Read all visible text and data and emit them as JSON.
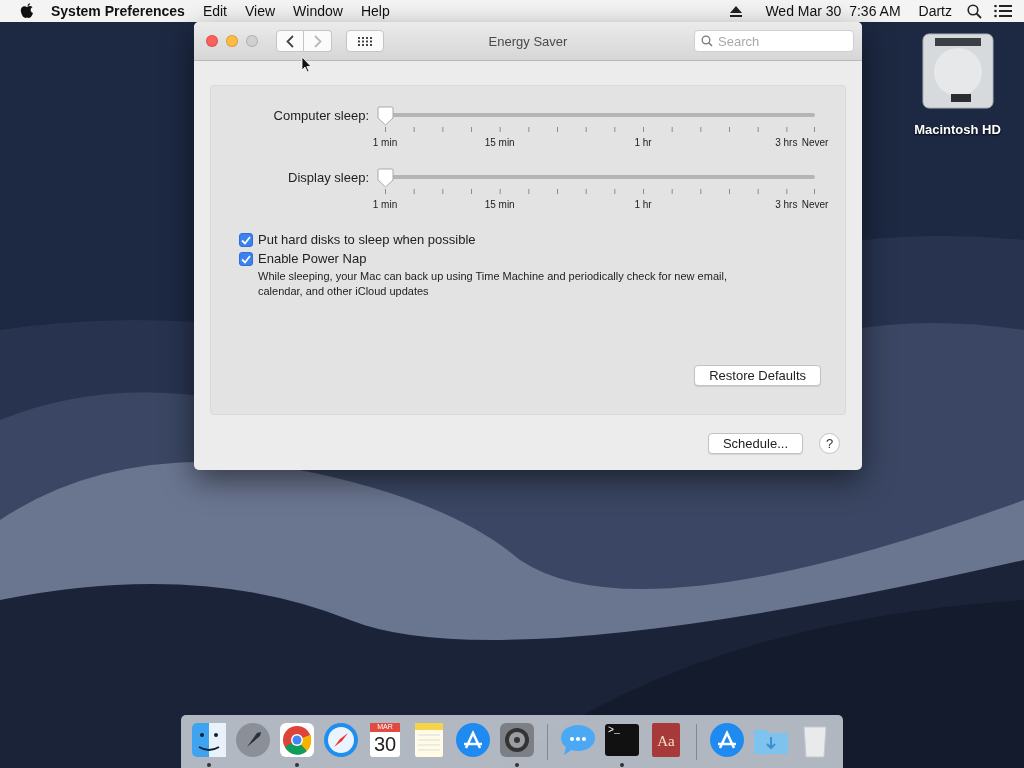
{
  "menu_bar": {
    "app_name": "System Preferences",
    "menus": [
      "Edit",
      "View",
      "Window",
      "Help"
    ],
    "clock": "Wed Mar 30  7:36 AM",
    "user": "Dartz"
  },
  "desktop_icons": [
    {
      "label": "Macintosh HD"
    }
  ],
  "window": {
    "title": "Energy Saver",
    "back_enabled": true,
    "forward_enabled": false,
    "search": {
      "placeholder": "Search"
    },
    "sliders": [
      {
        "label": "Computer sleep:",
        "level": 0,
        "tick_labels": [
          "1 min",
          "15 min",
          "1 hr",
          "3 hrs",
          "Never"
        ]
      },
      {
        "label": "Display sleep:",
        "level": 0,
        "tick_labels": [
          "1 min",
          "15 min",
          "1 hr",
          "3 hrs",
          "Never"
        ]
      }
    ],
    "checkboxes": [
      {
        "label": "Put hard disks to sleep when possible",
        "checked": true
      },
      {
        "label": "Enable Power Nap",
        "checked": true,
        "description": "While sleeping, your Mac can back up using Time Machine and periodically check for new email, calendar, and other iCloud updates"
      }
    ],
    "restore_button": "Restore Defaults",
    "schedule_button": "Schedule...",
    "help_button": "?"
  },
  "dock": {
    "items": [
      {
        "kind": "finder",
        "running": true
      },
      {
        "kind": "launchpad",
        "running": false
      },
      {
        "kind": "chrome",
        "running": true
      },
      {
        "kind": "safari",
        "running": false
      },
      {
        "kind": "calendar",
        "running": false,
        "month": "MAR",
        "day": "30"
      },
      {
        "kind": "notes",
        "running": false
      },
      {
        "kind": "appstore",
        "running": false
      },
      {
        "kind": "prefs",
        "running": true
      },
      {
        "kind": "separator"
      },
      {
        "kind": "messages",
        "running": false
      },
      {
        "kind": "terminal",
        "running": true,
        "prompt": ">_"
      },
      {
        "kind": "dictionary",
        "running": false,
        "text": "Aa"
      },
      {
        "kind": "separator"
      },
      {
        "kind": "appstore",
        "running": false
      },
      {
        "kind": "folder",
        "running": false
      },
      {
        "kind": "trash",
        "running": false
      }
    ]
  }
}
